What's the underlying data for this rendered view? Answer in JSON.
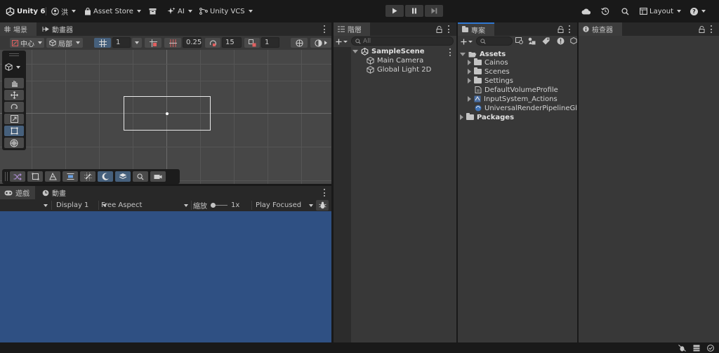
{
  "topbar": {
    "app_title": "Unity 6",
    "account_label": "洪",
    "asset_store_label": "Asset Store",
    "ai_label": "AI",
    "vcs_label": "Unity VCS",
    "layout_label": "Layout",
    "help_label": "?"
  },
  "scene_panel": {
    "tabs": [
      {
        "label": "場景"
      },
      {
        "label": "動畫器"
      }
    ],
    "toolbar": {
      "pivot_label": "中心",
      "space_label": "局部",
      "grid_value": "1",
      "snap_value": "0.25",
      "rotate_snap_value": "15",
      "scale_snap_value": "1"
    }
  },
  "game_panel": {
    "tabs": [
      {
        "label": "遊戲"
      },
      {
        "label": "動畫"
      }
    ],
    "display_label": "Display 1",
    "aspect_label": "Free Aspect",
    "scale_label": "縮放",
    "scale_value": "1x",
    "play_mode_label": "Play Focused",
    "game_background_color": "#2f5083"
  },
  "hierarchy": {
    "tab_label": "階層",
    "search_placeholder": "All",
    "scene_name": "SampleScene",
    "items": [
      {
        "label": "Main Camera"
      },
      {
        "label": "Global Light 2D"
      }
    ]
  },
  "project": {
    "tab_label": "專案",
    "root": "Assets",
    "items": [
      {
        "label": "Cainos",
        "type": "folder"
      },
      {
        "label": "Scenes",
        "type": "folder"
      },
      {
        "label": "Settings",
        "type": "folder"
      },
      {
        "label": "DefaultVolumeProfile",
        "type": "asset"
      },
      {
        "label": "InputSystem_Actions",
        "type": "asset"
      },
      {
        "label": "UniversalRenderPipelineGlob",
        "type": "asset"
      }
    ],
    "packages_label": "Packages"
  },
  "inspector": {
    "tab_label": "檢查器"
  }
}
